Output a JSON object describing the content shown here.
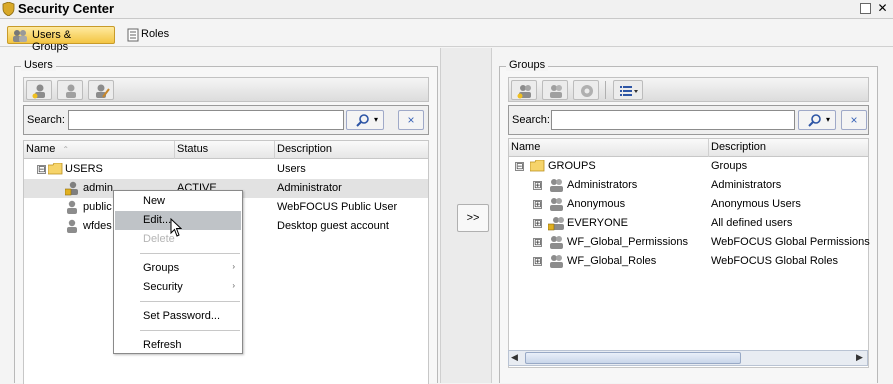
{
  "window": {
    "title": "Security Center",
    "app_icon": "shield-icon"
  },
  "tabs": [
    {
      "label": "Users & Groups",
      "icon": "users-icon",
      "active": true
    },
    {
      "label": "Roles",
      "icon": "document-icon",
      "active": false
    }
  ],
  "users_panel": {
    "title": "Users",
    "toolbar": [
      "new-user-icon",
      "user-properties-icon",
      "edit-user-icon"
    ],
    "search": {
      "label": "Search:",
      "value": "",
      "clear": "×"
    },
    "columns": [
      "Name",
      "Status",
      "Description"
    ],
    "root": {
      "expander": "⊟",
      "label": "USERS",
      "description": "Users"
    },
    "rows": [
      {
        "name": "admin",
        "status": "ACTIVE",
        "description": "Administrator"
      },
      {
        "name": "public",
        "status": "",
        "description": "WebFOCUS Public User"
      },
      {
        "name": "wfdes",
        "status": "",
        "description": "Desktop guest account"
      }
    ]
  },
  "context_menu": {
    "items": [
      {
        "label": "New"
      },
      {
        "label": "Edit..."
      },
      {
        "label": "Delete"
      },
      {
        "label": "Groups",
        "submenu": "›"
      },
      {
        "label": "Security",
        "submenu": "›"
      },
      {
        "label": "Set Password..."
      },
      {
        "label": "Refresh"
      }
    ]
  },
  "move_button": {
    "label": ">>"
  },
  "groups_panel": {
    "title": "Groups",
    "toolbar": [
      "new-group-icon",
      "group-properties-icon",
      "group-settings-icon",
      "list-view-icon"
    ],
    "search": {
      "label": "Search:",
      "value": "",
      "clear": "×"
    },
    "columns": [
      "Name",
      "Description"
    ],
    "root": {
      "expander": "⊟",
      "label": "GROUPS",
      "description": "Groups"
    },
    "rows": [
      {
        "expander": "⊞",
        "name": "Administrators",
        "description": "Administrators"
      },
      {
        "expander": "⊞",
        "name": "Anonymous",
        "description": "Anonymous Users"
      },
      {
        "expander": "⊞",
        "name": "EVERYONE",
        "description": "All defined users"
      },
      {
        "expander": "⊞",
        "name": "WF_Global_Permissions",
        "description": "WebFOCUS Global Permissions"
      },
      {
        "expander": "⊞",
        "name": "WF_Global_Roles",
        "description": "WebFOCUS Global Roles"
      }
    ]
  },
  "colors": {
    "tab_active": "#f3c543",
    "highlight": "#bfc3c7",
    "selected_row": "#e2e2e2"
  }
}
